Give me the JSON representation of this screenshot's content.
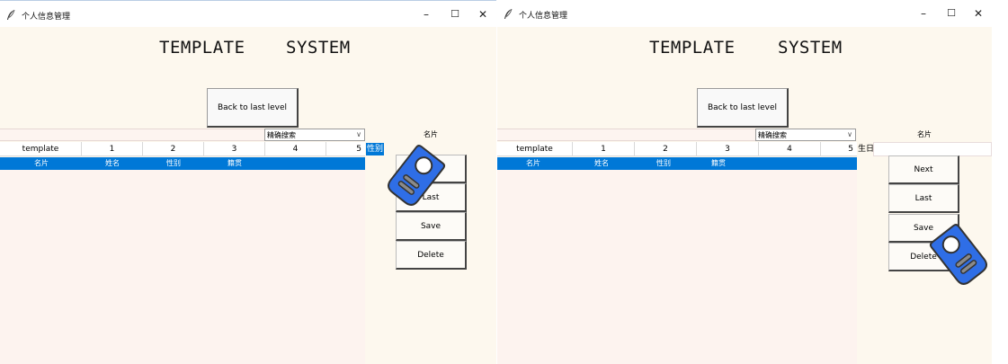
{
  "window_title": "个人信息管理",
  "heading_left": "TEMPLATE",
  "heading_right": "SYSTEM",
  "back_button": "Back to last level",
  "search_mode": "精确搜索",
  "side_header": "名片",
  "table_headers": [
    "template",
    "1",
    "2",
    "3",
    "4",
    "5"
  ],
  "row": [
    "名片",
    "姓名",
    "性别",
    "籍贯"
  ],
  "left_window": {
    "field_label": "性别",
    "buttons": [
      "Next",
      "Last",
      "Save",
      "Delete"
    ]
  },
  "right_window": {
    "field_label": "生日",
    "buttons": [
      "Next",
      "Last",
      "Save",
      "Delete"
    ]
  },
  "icons": [
    "feather-icon",
    "minimize-icon",
    "maximize-icon",
    "close-icon",
    "chevron-down-icon",
    "tag-cursor-icon"
  ],
  "colors": {
    "selection": "#0078d7",
    "window_bg": "#fdf8ee",
    "cursor_blue": "#2f6ee6"
  }
}
